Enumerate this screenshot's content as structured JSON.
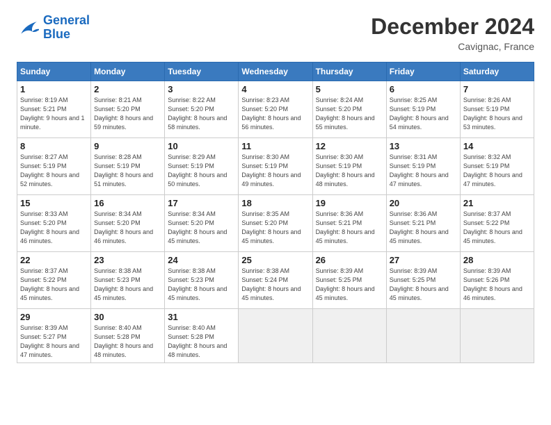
{
  "logo": {
    "line1": "General",
    "line2": "Blue"
  },
  "title": "December 2024",
  "location": "Cavignac, France",
  "days_header": [
    "Sunday",
    "Monday",
    "Tuesday",
    "Wednesday",
    "Thursday",
    "Friday",
    "Saturday"
  ],
  "weeks": [
    [
      {
        "day": "1",
        "rise": "8:19 AM",
        "set": "5:21 PM",
        "daylight": "9 hours and 1 minute."
      },
      {
        "day": "2",
        "rise": "8:21 AM",
        "set": "5:20 PM",
        "daylight": "8 hours and 59 minutes."
      },
      {
        "day": "3",
        "rise": "8:22 AM",
        "set": "5:20 PM",
        "daylight": "8 hours and 58 minutes."
      },
      {
        "day": "4",
        "rise": "8:23 AM",
        "set": "5:20 PM",
        "daylight": "8 hours and 56 minutes."
      },
      {
        "day": "5",
        "rise": "8:24 AM",
        "set": "5:20 PM",
        "daylight": "8 hours and 55 minutes."
      },
      {
        "day": "6",
        "rise": "8:25 AM",
        "set": "5:19 PM",
        "daylight": "8 hours and 54 minutes."
      },
      {
        "day": "7",
        "rise": "8:26 AM",
        "set": "5:19 PM",
        "daylight": "8 hours and 53 minutes."
      }
    ],
    [
      {
        "day": "8",
        "rise": "8:27 AM",
        "set": "5:19 PM",
        "daylight": "8 hours and 52 minutes."
      },
      {
        "day": "9",
        "rise": "8:28 AM",
        "set": "5:19 PM",
        "daylight": "8 hours and 51 minutes."
      },
      {
        "day": "10",
        "rise": "8:29 AM",
        "set": "5:19 PM",
        "daylight": "8 hours and 50 minutes."
      },
      {
        "day": "11",
        "rise": "8:30 AM",
        "set": "5:19 PM",
        "daylight": "8 hours and 49 minutes."
      },
      {
        "day": "12",
        "rise": "8:30 AM",
        "set": "5:19 PM",
        "daylight": "8 hours and 48 minutes."
      },
      {
        "day": "13",
        "rise": "8:31 AM",
        "set": "5:19 PM",
        "daylight": "8 hours and 47 minutes."
      },
      {
        "day": "14",
        "rise": "8:32 AM",
        "set": "5:19 PM",
        "daylight": "8 hours and 47 minutes."
      }
    ],
    [
      {
        "day": "15",
        "rise": "8:33 AM",
        "set": "5:20 PM",
        "daylight": "8 hours and 46 minutes."
      },
      {
        "day": "16",
        "rise": "8:34 AM",
        "set": "5:20 PM",
        "daylight": "8 hours and 46 minutes."
      },
      {
        "day": "17",
        "rise": "8:34 AM",
        "set": "5:20 PM",
        "daylight": "8 hours and 45 minutes."
      },
      {
        "day": "18",
        "rise": "8:35 AM",
        "set": "5:20 PM",
        "daylight": "8 hours and 45 minutes."
      },
      {
        "day": "19",
        "rise": "8:36 AM",
        "set": "5:21 PM",
        "daylight": "8 hours and 45 minutes."
      },
      {
        "day": "20",
        "rise": "8:36 AM",
        "set": "5:21 PM",
        "daylight": "8 hours and 45 minutes."
      },
      {
        "day": "21",
        "rise": "8:37 AM",
        "set": "5:22 PM",
        "daylight": "8 hours and 45 minutes."
      }
    ],
    [
      {
        "day": "22",
        "rise": "8:37 AM",
        "set": "5:22 PM",
        "daylight": "8 hours and 45 minutes."
      },
      {
        "day": "23",
        "rise": "8:38 AM",
        "set": "5:23 PM",
        "daylight": "8 hours and 45 minutes."
      },
      {
        "day": "24",
        "rise": "8:38 AM",
        "set": "5:23 PM",
        "daylight": "8 hours and 45 minutes."
      },
      {
        "day": "25",
        "rise": "8:38 AM",
        "set": "5:24 PM",
        "daylight": "8 hours and 45 minutes."
      },
      {
        "day": "26",
        "rise": "8:39 AM",
        "set": "5:25 PM",
        "daylight": "8 hours and 45 minutes."
      },
      {
        "day": "27",
        "rise": "8:39 AM",
        "set": "5:25 PM",
        "daylight": "8 hours and 45 minutes."
      },
      {
        "day": "28",
        "rise": "8:39 AM",
        "set": "5:26 PM",
        "daylight": "8 hours and 46 minutes."
      }
    ],
    [
      {
        "day": "29",
        "rise": "8:39 AM",
        "set": "5:27 PM",
        "daylight": "8 hours and 47 minutes."
      },
      {
        "day": "30",
        "rise": "8:40 AM",
        "set": "5:28 PM",
        "daylight": "8 hours and 48 minutes."
      },
      {
        "day": "31",
        "rise": "8:40 AM",
        "set": "5:28 PM",
        "daylight": "8 hours and 48 minutes."
      },
      null,
      null,
      null,
      null
    ]
  ]
}
